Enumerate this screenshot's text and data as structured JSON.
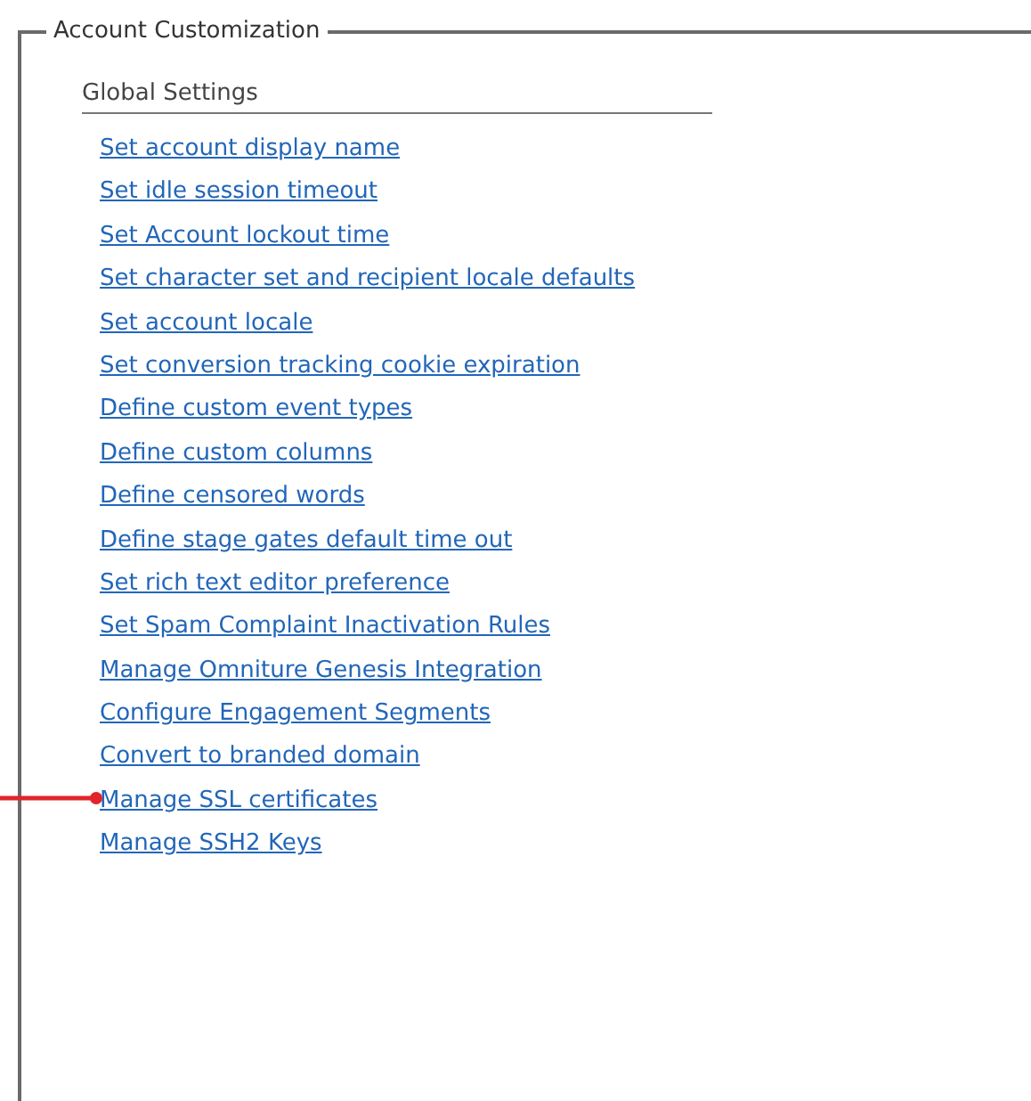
{
  "panel": {
    "legend": "Account Customization",
    "section_title": "Global Settings",
    "links": [
      {
        "label": "Set account display name",
        "marked": false
      },
      {
        "label": "Set idle session timeout",
        "marked": false
      },
      {
        "label": "Set Account lockout time",
        "marked": false
      },
      {
        "label": "Set character set and recipient locale defaults",
        "marked": false
      },
      {
        "label": "Set account locale",
        "marked": false
      },
      {
        "label": "Set conversion tracking cookie expiration",
        "marked": false
      },
      {
        "label": "Define custom event types",
        "marked": false
      },
      {
        "label": "Define custom columns",
        "marked": false
      },
      {
        "label": "Define censored words",
        "marked": false
      },
      {
        "label": "Define stage gates default time out",
        "marked": false
      },
      {
        "label": "Set rich text editor preference",
        "marked": false
      },
      {
        "label": "Set Spam Complaint Inactivation Rules",
        "marked": false
      },
      {
        "label": "Manage Omniture Genesis Integration",
        "marked": false
      },
      {
        "label": "Configure Engagement Segments",
        "marked": false
      },
      {
        "label": "Convert to branded domain",
        "marked": false
      },
      {
        "label": "Manage SSL certificates",
        "marked": true
      },
      {
        "label": "Manage SSH2 Keys",
        "marked": false
      }
    ]
  }
}
